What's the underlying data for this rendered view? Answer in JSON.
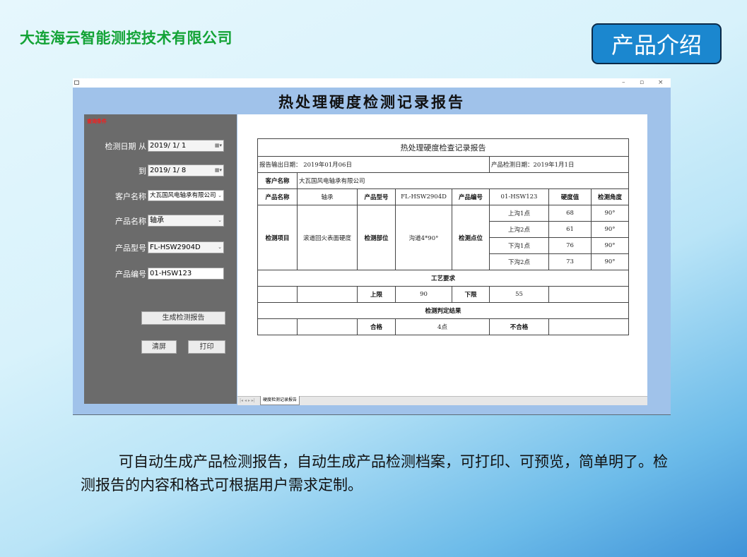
{
  "slide": {
    "company": "大连海云智能测控技术有限公司",
    "badge": "产品介绍",
    "description": "可自动生成产品检测报告，自动生成产品检测档案，可打印、可预览，简单明了。检测报告的内容和格式可根据用户需求定制。"
  },
  "window": {
    "controls": {
      "minimize": "–",
      "restore": "▫",
      "close": "×"
    },
    "heading": "热处理硬度检测记录报告"
  },
  "query_panel": {
    "title": "查询条件",
    "date_from_label": "检测日期 从",
    "date_from": "2019/ 1/ 1",
    "date_to_label": "到",
    "date_to": "2019/ 1/ 8",
    "customer_label": "客户名称",
    "customer": "大瓦国风电轴承有限公司",
    "product_name_label": "产品名称",
    "product_name": "轴承",
    "product_model_label": "产品型号",
    "product_model": "FL-HSW2904D",
    "product_code_label": "产品编号",
    "product_code": "01-HSW123",
    "generate_button": "生成检测报告",
    "clear_button": "清屏",
    "print_button": "打印"
  },
  "preview": {
    "tab_nav": "|◂ ◂ ▸ ▸|",
    "tab_label": "硬度检测记录报告"
  },
  "report": {
    "title": "热处理硬度检查记录报告",
    "output_date": "报告输出日期： 2019年01月06日",
    "inspect_date": "产品检测日期：2019年1月1日",
    "customer_label": "客户名称",
    "customer": "大瓦国风电轴承有限公司",
    "product_name_label": "产品名称",
    "product_name": "轴承",
    "product_model_label": "产品型号",
    "product_model": "FL-HSW2904D",
    "product_code_label": "产品编号",
    "product_code": "01-HSW123",
    "hardness_label": "硬度值",
    "angle_label": "检测角度",
    "item_label": "检测项目",
    "item": "滚道回火表面硬度",
    "part_label": "检测部位",
    "part": "沟道4*90°",
    "point_label": "检测点位",
    "points": [
      {
        "name": "上沟1点",
        "hardness": "68",
        "angle": "90°"
      },
      {
        "name": "上沟2点",
        "hardness": "61",
        "angle": "90°"
      },
      {
        "name": "下沟1点",
        "hardness": "76",
        "angle": "90°"
      },
      {
        "name": "下沟2点",
        "hardness": "73",
        "angle": "90°"
      }
    ],
    "process_header": "工艺要求",
    "upper_label": "上限",
    "upper": "90",
    "lower_label": "下限",
    "lower": "55",
    "result_header": "检测判定结果",
    "pass_label": "合格",
    "pass_count": "4点",
    "fail_label": "不合格",
    "fail_count": ""
  }
}
